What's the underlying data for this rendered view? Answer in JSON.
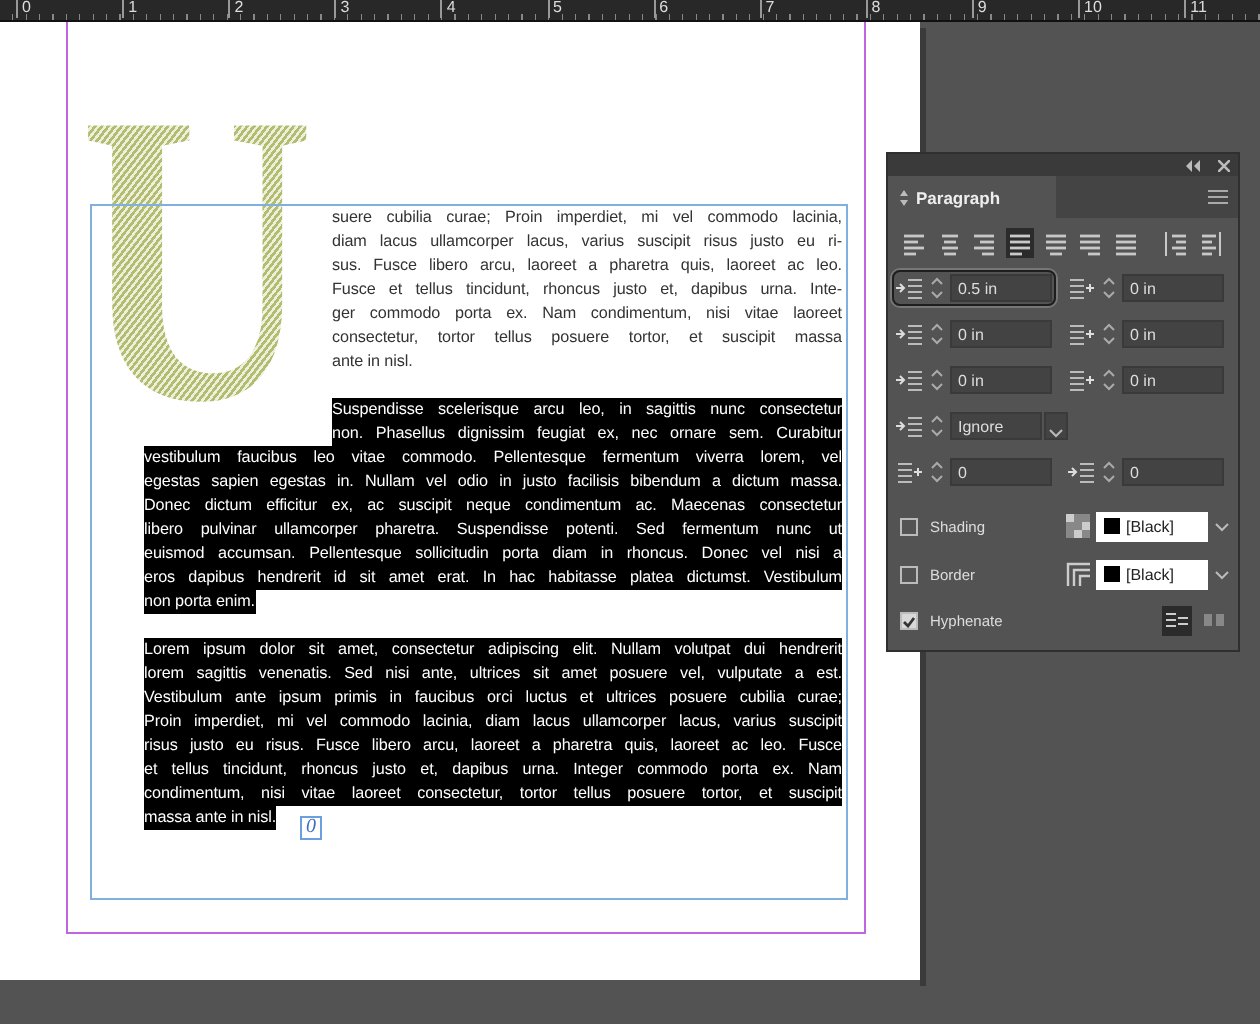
{
  "ruler": {
    "labels": [
      "0",
      "1",
      "2",
      "3",
      "4",
      "5",
      "6",
      "7",
      "8",
      "9",
      "10",
      "11"
    ]
  },
  "document": {
    "drop_cap": "U",
    "frame_marker": "0",
    "paragraphs": [
      {
        "selected": false,
        "lines_beside_cap": [
          "suere cubilia curae; Proin imperdiet, mi vel commodo lacinia,",
          "diam lacus ullamcorper lacus, varius suscipit risus justo eu ri-",
          "sus. Fusce libero arcu, laoreet a pharetra quis, laoreet ac leo.",
          "Fusce et tellus tincidunt, rhoncus justo et, dapibus urna. Inte-",
          "ger commodo porta ex. Nam condimentum, nisi vitae laoreet",
          "consectetur, tortor tellus posuere tortor, et suscipit massa",
          "ante in nisl."
        ]
      },
      {
        "selected": true,
        "lines_beside_cap": [
          "Suspendisse scelerisque arcu leo, in sagittis nunc consectetur",
          "non. Phasellus dignissim feugiat ex, nec ornare sem. Curabitur"
        ],
        "lines": [
          "vestibulum faucibus leo vitae commodo. Pellentesque fermentum viverra lorem, vel",
          "egestas sapien egestas in. Nullam vel odio in justo facilisis bibendum a dictum massa.",
          "Donec dictum efficitur ex, ac suscipit neque condimentum ac. Maecenas consectetur",
          "libero pulvinar ullamcorper pharetra. Suspendisse potenti. Sed fermentum nunc ut",
          "euismod accumsan. Pellentesque sollicitudin porta diam in rhoncus. Donec vel nisi a",
          "eros dapibus hendrerit id sit amet erat. In hac habitasse platea dictumst. Vestibulum",
          "non porta enim."
        ]
      },
      {
        "selected": true,
        "lines": [
          "Lorem ipsum dolor sit amet, consectetur adipiscing elit. Nullam volutpat dui hendrerit",
          "lorem sagittis venenatis. Sed nisi ante, ultrices sit amet posuere vel, vulputate a est.",
          "Vestibulum ante ipsum primis in faucibus orci luctus et ultrices posuere cubilia curae;",
          "Proin imperdiet, mi vel commodo lacinia, diam lacus ullamcorper lacus, varius suscipit",
          "risus justo eu risus. Fusce libero arcu, laoreet a pharetra quis, laoreet ac leo. Fusce",
          "et tellus tincidunt, rhoncus justo et, dapibus urna. Integer commodo porta ex. Nam",
          "condimentum, nisi vitae laoreet consectetur, tortor tellus posuere tortor, et suscipit",
          "massa ante in nisl."
        ]
      }
    ]
  },
  "panel": {
    "title": "Paragraph",
    "alignments": [
      {
        "selected": false
      },
      {
        "selected": false
      },
      {
        "selected": false
      },
      {
        "selected": true
      },
      {
        "selected": false
      },
      {
        "selected": false
      },
      {
        "selected": false
      },
      {
        "selected": false
      },
      {
        "selected": false
      }
    ],
    "fields": [
      {
        "kind": "spin",
        "value": "0.5 in",
        "highlighted": true
      },
      {
        "kind": "spin",
        "value": "0 in",
        "highlighted": false
      },
      {
        "kind": "spin",
        "value": "0 in",
        "highlighted": false
      },
      {
        "kind": "spin",
        "value": "0 in",
        "highlighted": false
      },
      {
        "kind": "spin",
        "value": "0 in",
        "highlighted": false
      },
      {
        "kind": "spin",
        "value": "0 in",
        "highlighted": false
      },
      {
        "kind": "dropdown",
        "value": "Ignore",
        "highlighted": false
      },
      {
        "kind": "spin",
        "value": "0",
        "highlighted": false
      },
      {
        "kind": "spin",
        "value": "0",
        "highlighted": false
      }
    ],
    "options": [
      {
        "label": "Shading",
        "checked": false,
        "swatch": "[Black]"
      },
      {
        "label": "Border",
        "checked": false,
        "swatch": "[Black]"
      }
    ],
    "hyphenate": {
      "label": "Hyphenate",
      "checked": true
    },
    "span_buttons": [
      {
        "selected": true
      },
      {
        "selected": false
      }
    ]
  }
}
